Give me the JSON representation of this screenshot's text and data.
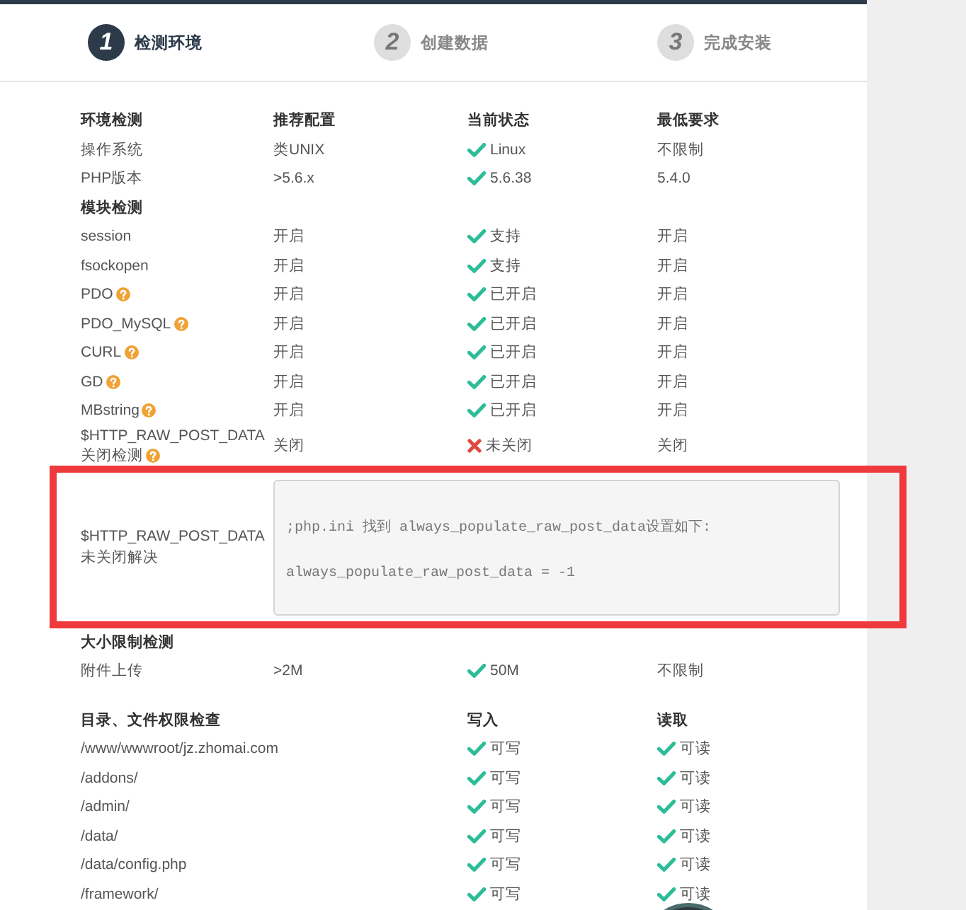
{
  "steps": [
    {
      "number": "1",
      "label": "检测环境",
      "selected": true
    },
    {
      "number": "2",
      "label": "创建数据",
      "selected": false
    },
    {
      "number": "3",
      "label": "完成安装",
      "selected": false
    }
  ],
  "environment": {
    "columns": [
      "环境检测",
      "推荐配置",
      "当前状态",
      "最低要求"
    ],
    "rows": [
      {
        "name": "操作系统",
        "recommended": "类UNIX",
        "status": "Linux",
        "passed": true,
        "minimum": "不限制"
      },
      {
        "name": "PHP版本",
        "recommended": ">5.6.x",
        "status": "5.6.38",
        "passed": true,
        "minimum": "5.4.0"
      }
    ]
  },
  "modules": {
    "title": "模块检测",
    "rows": [
      {
        "name": "session",
        "help": false,
        "recommended": "开启",
        "status": "支持",
        "passed": true,
        "minimum": "开启"
      },
      {
        "name": "fsockopen",
        "help": false,
        "recommended": "开启",
        "status": "支持",
        "passed": true,
        "minimum": "开启"
      },
      {
        "name": "PDO",
        "help": true,
        "recommended": "开启",
        "status": "已开启",
        "passed": true,
        "minimum": "开启"
      },
      {
        "name": "PDO_MySQL",
        "help": true,
        "recommended": "开启",
        "status": "已开启",
        "passed": true,
        "minimum": "开启"
      },
      {
        "name": "CURL",
        "help": true,
        "recommended": "开启",
        "status": "已开启",
        "passed": true,
        "minimum": "开启"
      },
      {
        "name": "GD",
        "help": true,
        "recommended": "开启",
        "status": "已开启",
        "passed": true,
        "minimum": "开启"
      },
      {
        "name": "MBstring",
        "help": true,
        "recommended": "开启",
        "status": "已开启",
        "passed": true,
        "minimum": "开启"
      },
      {
        "name": "$HTTP_RAW_POST_DATA 关闭检测",
        "help": true,
        "recommended": "关闭",
        "status": "未关闭",
        "passed": false,
        "minimum": "关闭"
      }
    ]
  },
  "fix": {
    "label": "$HTTP_RAW_POST_DATA 未关闭解决",
    "code": [
      ";php.ini 找到 always_populate_raw_post_data设置如下:",
      "always_populate_raw_post_data = -1"
    ]
  },
  "size_limits": {
    "title": "大小限制检测",
    "rows": [
      {
        "name": "附件上传",
        "recommended": ">2M",
        "status": "50M",
        "passed": true,
        "minimum": "不限制"
      }
    ]
  },
  "permissions": {
    "columns": [
      "目录、文件权限检查",
      "写入",
      "读取"
    ],
    "rows": [
      {
        "path": "/www/wwwroot/jz.zhomai.com",
        "write": "可写",
        "write_ok": true,
        "read": "可读",
        "read_ok": true
      },
      {
        "path": "/addons/",
        "write": "可写",
        "write_ok": true,
        "read": "可读",
        "read_ok": true
      },
      {
        "path": "/admin/",
        "write": "可写",
        "write_ok": true,
        "read": "可读",
        "read_ok": true
      },
      {
        "path": "/data/",
        "write": "可写",
        "write_ok": true,
        "read": "可读",
        "read_ok": true
      },
      {
        "path": "/data/config.php",
        "write": "可写",
        "write_ok": true,
        "read": "可读",
        "read_ok": true
      },
      {
        "path": "/framework/",
        "write": "可写",
        "write_ok": true,
        "read": "可读",
        "read_ok": true
      }
    ]
  }
}
